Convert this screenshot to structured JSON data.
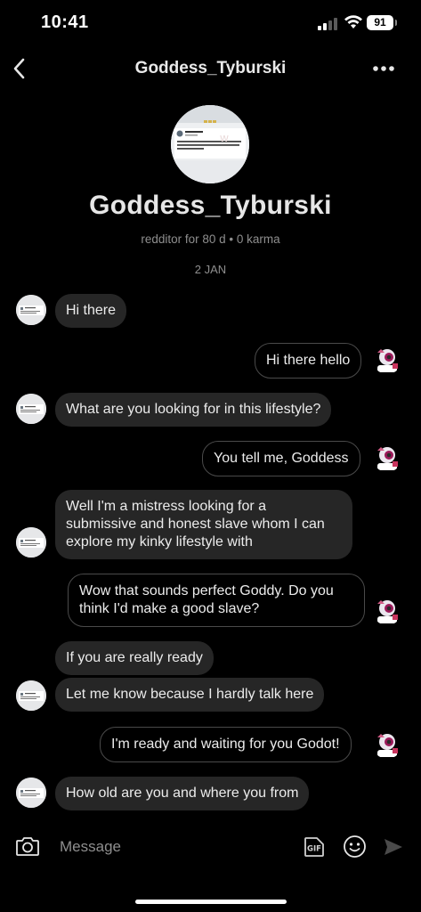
{
  "status_bar": {
    "time": "10:41",
    "battery": "91"
  },
  "header": {
    "title": "Goddess_Tyburski"
  },
  "profile": {
    "name": "Goddess_Tyburski",
    "meta": "redditor for 80 d • 0 karma",
    "thumbnail_text": "wait so if your birthday is February 29, what happens when the year don't have February 29??"
  },
  "conversation": {
    "date": "2 JAN",
    "messages": [
      {
        "from": "them",
        "text": "Hi there"
      },
      {
        "from": "me",
        "text": "Hi there hello"
      },
      {
        "from": "them",
        "text": "What are you looking for in this lifestyle?"
      },
      {
        "from": "me",
        "text": "You tell me, Goddess"
      },
      {
        "from": "them",
        "lines": [
          "Well I'm a mistress looking for a",
          "submissive and honest slave whom I can",
          "explore my kinky lifestyle with"
        ]
      },
      {
        "from": "me",
        "lines": [
          "Wow that sounds perfect Goddy. Do you",
          "think I'd make a good slave?"
        ]
      },
      {
        "from": "them",
        "text": "If you are really ready"
      },
      {
        "from": "them",
        "text": "Let me know because I hardly talk here"
      },
      {
        "from": "me",
        "text": "I'm ready and waiting for you Godot!"
      },
      {
        "from": "them",
        "text": "How old are you and where you from"
      }
    ]
  },
  "composer": {
    "placeholder": "Message",
    "gif_label": "GIF"
  },
  "icons": {
    "back": "chevron-left-icon",
    "more": "more-horizontal-icon",
    "camera": "camera-icon",
    "gif": "gif-icon",
    "emoji": "emoji-icon",
    "send": "send-icon"
  }
}
